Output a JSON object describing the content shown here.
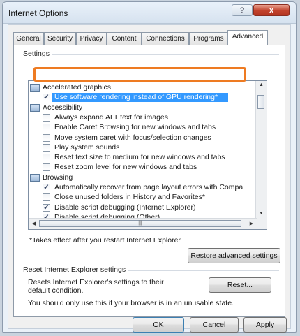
{
  "window": {
    "title": "Internet Options",
    "help_glyph": "?",
    "close_glyph": "x"
  },
  "tabs": [
    {
      "label": "General"
    },
    {
      "label": "Security"
    },
    {
      "label": "Privacy"
    },
    {
      "label": "Content"
    },
    {
      "label": "Connections"
    },
    {
      "label": "Programs"
    },
    {
      "label": "Advanced",
      "active": true
    }
  ],
  "settings": {
    "label": "Settings",
    "items": [
      {
        "type": "category",
        "label": "Accelerated graphics",
        "icon": "category-icon"
      },
      {
        "type": "checkbox",
        "label": "Use software rendering instead of GPU rendering*",
        "checked": true,
        "selected": true
      },
      {
        "type": "category",
        "label": "Accessibility",
        "icon": "accessibility-icon"
      },
      {
        "type": "checkbox",
        "label": "Always expand ALT text for images",
        "checked": false
      },
      {
        "type": "checkbox",
        "label": "Enable Caret Browsing for new windows and tabs",
        "checked": false
      },
      {
        "type": "checkbox",
        "label": "Move system caret with focus/selection changes",
        "checked": false
      },
      {
        "type": "checkbox",
        "label": "Play system sounds",
        "checked": false
      },
      {
        "type": "checkbox",
        "label": "Reset text size to medium for new windows and tabs",
        "checked": false
      },
      {
        "type": "checkbox",
        "label": "Reset zoom level for new windows and tabs",
        "checked": false
      },
      {
        "type": "category",
        "label": "Browsing",
        "icon": "category-icon"
      },
      {
        "type": "checkbox",
        "label": "Automatically recover from page layout errors with Compa",
        "checked": true
      },
      {
        "type": "checkbox",
        "label": "Close unused folders in History and Favorites*",
        "checked": false
      },
      {
        "type": "checkbox",
        "label": "Disable script debugging (Internet Explorer)",
        "checked": true
      },
      {
        "type": "checkbox",
        "label": "Disable script debugging (Other)",
        "checked": true
      }
    ],
    "footnote": "*Takes effect after you restart Internet Explorer",
    "restore_button": "Restore advanced settings"
  },
  "reset": {
    "label": "Reset Internet Explorer settings",
    "description": "Resets Internet Explorer's settings to their default condition.",
    "button": "Reset...",
    "warning": "You should only use this if your browser is in an unusable state."
  },
  "footer": {
    "ok": "OK",
    "cancel": "Cancel",
    "apply": "Apply"
  },
  "colors": {
    "highlight_outline": "#ee7b22",
    "selection": "#3399ff",
    "close_button": "#c2432d"
  }
}
